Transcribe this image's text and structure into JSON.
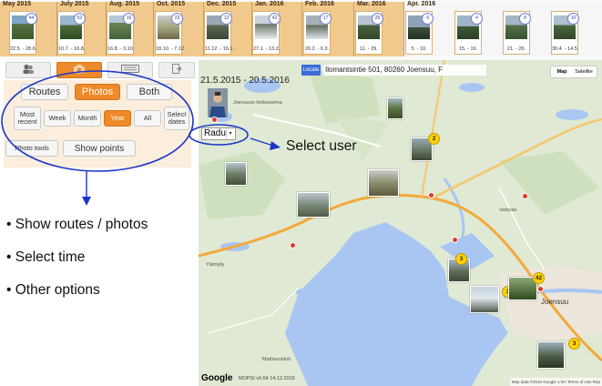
{
  "timeline": {
    "months": [
      {
        "label": "May 2015"
      },
      {
        "label": "July 2015"
      },
      {
        "label": "Aug. 2015"
      },
      {
        "label": "Oct. 2015"
      },
      {
        "label": "Dec. 2015"
      },
      {
        "label": "Jan. 2016"
      },
      {
        "label": "Feb. 2016"
      },
      {
        "label": "Mar. 2016"
      },
      {
        "label": "Apr. 2016"
      }
    ],
    "thumbs": [
      {
        "dates": "22.5. - 28.6.",
        "count": "44"
      },
      {
        "dates": "10.7. - 10.8.",
        "count": "52"
      },
      {
        "dates": "16.8. - 3.10.",
        "count": "16"
      },
      {
        "dates": "18.10. - 7.12.",
        "count": "23"
      },
      {
        "dates": "11.12. - 16.1.",
        "count": "13"
      },
      {
        "dates": "27.1. - 13.2.",
        "count": "42"
      },
      {
        "dates": "20.2. - 6.3.",
        "count": "17"
      },
      {
        "dates": "11. - 29.",
        "count": "25"
      },
      {
        "dates": "5. - 10.",
        "count": "9"
      },
      {
        "dates": "15. - 19.",
        "count": "4"
      },
      {
        "dates": "21. - 26.",
        "count": "8"
      },
      {
        "dates": "30.4. - 14.5.",
        "count": "10"
      }
    ]
  },
  "panel": {
    "tabs": [
      "people-icon",
      "camera-icon",
      "keyboard-icon",
      "export-icon"
    ],
    "active_tab": 1,
    "routes_label": "Routes",
    "photos_label": "Photos",
    "both_label": "Both",
    "most_recent_label": "Most recent",
    "week_label": "Week",
    "month_label": "Month",
    "year_label": "Year",
    "all_label": "All",
    "select_dates_label": "Select dates",
    "photo_tools_label": "Photo tools",
    "show_points_label": "Show points"
  },
  "map": {
    "locate_label": "Locate",
    "address": "Ilomantsintie 501, 80260 Joensuu, F",
    "map_type": [
      "Map",
      "Satellite"
    ],
    "date_range": "21.5.2015 - 20.5.2016",
    "user": "Radu",
    "cluster_counts": [
      "2",
      "3",
      "3",
      "42",
      "3"
    ],
    "place_labels": [
      "Joensuun lentoasema",
      "Ylämylly",
      "Vaitsola",
      "Joensuu",
      "Mattisenlahti"
    ],
    "google_label": "Google",
    "version": "MOPSI v0.64 14.12.2015",
    "attribution": "Map data ©2016 Google   1 km      Terms of Use   Rep"
  },
  "annotations": {
    "select_user": "Select user",
    "bullets": [
      "Show routes / photos",
      "Select time",
      "Other options"
    ]
  },
  "colors": {
    "accent_orange": "#ee8a2a",
    "annotation_blue": "#1c37c8",
    "cluster_yellow": "#ffd200",
    "timeline_tan": "#f2c98c",
    "lake_blue": "#a9c6f2"
  }
}
